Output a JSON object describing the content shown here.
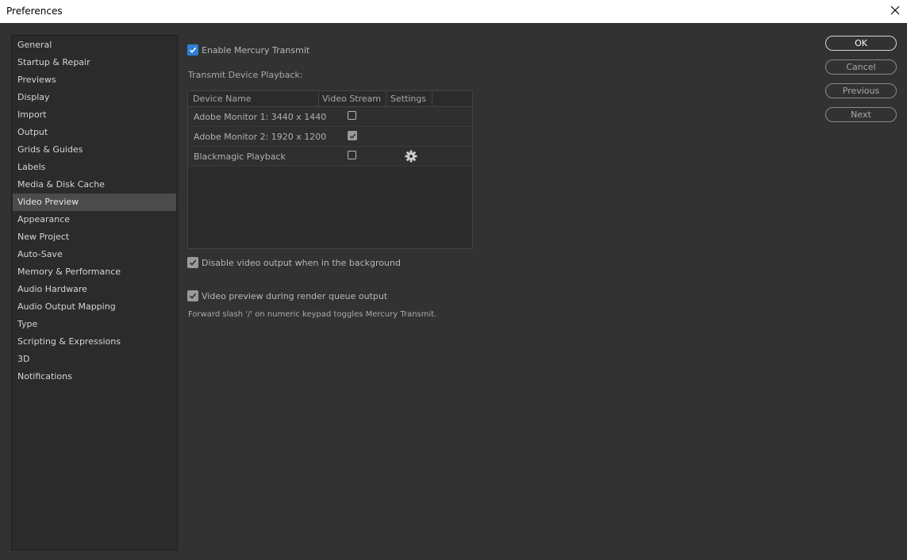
{
  "window": {
    "title": "Preferences"
  },
  "sidebar": {
    "items": [
      "General",
      "Startup & Repair",
      "Previews",
      "Display",
      "Import",
      "Output",
      "Grids & Guides",
      "Labels",
      "Media & Disk Cache",
      "Video Preview",
      "Appearance",
      "New Project",
      "Auto-Save",
      "Memory & Performance",
      "Audio Hardware",
      "Audio Output Mapping",
      "Type",
      "Scripting & Expressions",
      "3D",
      "Notifications"
    ],
    "selected": "Video Preview"
  },
  "main": {
    "enable_transmit": {
      "label": "Enable Mercury Transmit",
      "checked": true
    },
    "transmit_heading": "Transmit Device Playback:",
    "table": {
      "columns": [
        "Device Name",
        "Video Stream",
        "Settings"
      ],
      "rows": [
        {
          "name": "Adobe Monitor 1: 3440 x 1440",
          "video_stream": false,
          "settings": ""
        },
        {
          "name": "Adobe Monitor 2: 1920 x 1200",
          "video_stream": true,
          "settings": ""
        },
        {
          "name": "Blackmagic Playback",
          "video_stream": false,
          "settings": "gear-icon"
        }
      ]
    },
    "disable_background": {
      "label": "Disable video output when in the background",
      "checked": true
    },
    "render_queue_preview": {
      "label": "Video preview during render queue output",
      "checked": true
    },
    "hint": "Forward slash '/' on numeric keypad toggles Mercury Transmit."
  },
  "buttons": {
    "ok": "OK",
    "cancel": "Cancel",
    "previous": "Previous",
    "next": "Next"
  },
  "colors": {
    "accent": "#2d7ed5",
    "background": "#323232",
    "panel": "#2b2b2b",
    "selected": "#4b4b4b"
  }
}
